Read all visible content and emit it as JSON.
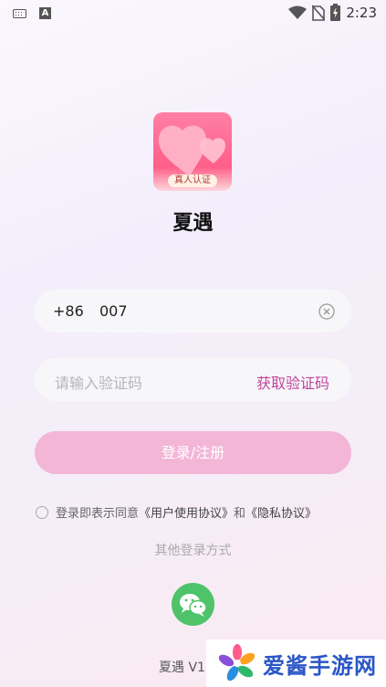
{
  "status_bar": {
    "time": "2:23",
    "icons": [
      "keyboard-icon",
      "a-icon",
      "wifi-icon",
      "no-sim-icon",
      "battery-icon"
    ]
  },
  "app": {
    "logo_badge": "真人认证",
    "name": "夏遇"
  },
  "login_form": {
    "country_code": "+86",
    "phone_value": "007",
    "code_placeholder": "请输入验证码",
    "get_code_label": "获取验证码",
    "submit_label": "登录/注册"
  },
  "agreement": {
    "prefix": "登录即表示同意",
    "user_agreement": "《用户使用协议》",
    "conjunction": "和",
    "privacy_policy": "《隐私协议》"
  },
  "other_login": {
    "label": "其他登录方式",
    "methods": [
      "wechat-icon"
    ]
  },
  "footer": {
    "version": "夏遇 V1"
  },
  "watermark": {
    "text": "爱酱手游网"
  },
  "colors": {
    "accent": "#c0459d",
    "button": "#f3b6d7",
    "wechat": "#4fc36a",
    "logo": "#ff5f89"
  }
}
